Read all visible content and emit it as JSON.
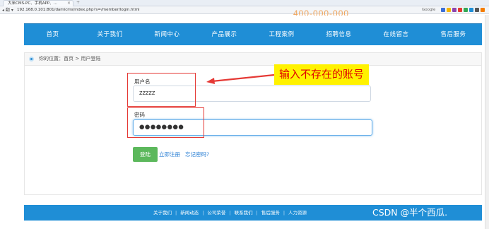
{
  "browser": {
    "tab_title": "大米CMS-PC、手机APP、...",
    "tab_close": "×",
    "new_tab": "+",
    "nav_controls": "◂ 翻 ▾",
    "url": "192.168.0.101:801/damicms/index.php?s=/member/login.html",
    "search_engine": "Google"
  },
  "site": {
    "phone": "400-000-000",
    "nav": [
      "首页",
      "关于我们",
      "新闻中心",
      "产品展示",
      "工程案例",
      "招聘信息",
      "在线留言",
      "售后服务"
    ]
  },
  "breadcrumb": {
    "prefix": "你的位置：",
    "home": "首页",
    "separator": " > ",
    "current": "用户登陆"
  },
  "form": {
    "username_label": "用户名",
    "username_value": "zzzzz",
    "password_label": "密码",
    "password_value": "●●●●●●●●",
    "login_button": "登陆",
    "register_link": "立即注册",
    "forgot_link": "忘记密码?"
  },
  "annotation": {
    "callout_text": "输入不存在的账号",
    "highlight_color": "#e53935",
    "callout_bg": "#fff200"
  },
  "footer": {
    "links": [
      "关于我们",
      "新闻动态",
      "公司荣誉",
      "联系我们",
      "售后服务",
      "人力资源"
    ],
    "separator": "|"
  },
  "watermark": "CSDN @半个西瓜.",
  "colors": {
    "nav_blue": "#1f8ed6",
    "login_green": "#5cb85c",
    "link_blue": "#2a7fd4"
  }
}
